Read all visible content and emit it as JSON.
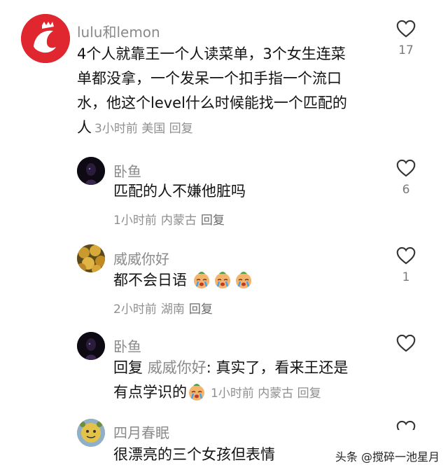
{
  "comments": [
    {
      "username": "lulu和lemon",
      "lines": [
        "4个人就靠王一个人读菜单，3个女生连菜",
        "单都没拿，一个发呆一个扣手指一个流口",
        "水，他这个level什么时候能找一个匹配的",
        "人"
      ],
      "time": "3小时前",
      "location": "美国",
      "reply_label": "回复",
      "likes": "17"
    },
    {
      "username": "卧鱼",
      "text": "匹配的人不嫌他脏吗",
      "time": "1小时前",
      "location": "内蒙古",
      "reply_label": "回复",
      "likes": "6"
    },
    {
      "username": "威威你好",
      "text": "都不会日语",
      "time": "2小时前",
      "location": "湖南",
      "reply_label": "回复",
      "likes": "1"
    },
    {
      "username": "卧鱼",
      "reply_prefix": "回复",
      "reply_to": "威威你好",
      "line1_rest": ": 真实了，看来王还是",
      "line2": "有点学识的",
      "time": "1小时前",
      "location": "内蒙古",
      "reply_label": "回复"
    },
    {
      "username": "四月春眠",
      "text": "很漂亮的三个女孩但表情"
    }
  ],
  "watermark": {
    "text": "头条 @搅碎一池星月"
  },
  "colors": {
    "text": "#121212",
    "username": "#8a8a8a",
    "meta": "#8f8f8f",
    "brand_red": "#e0262f"
  }
}
